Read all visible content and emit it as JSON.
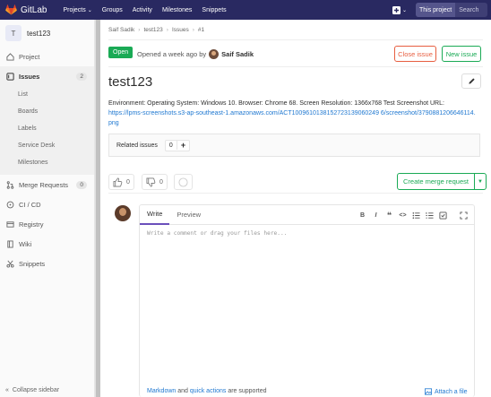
{
  "navbar": {
    "brand": "GitLab",
    "links": [
      "Projects",
      "Groups",
      "Activity",
      "Milestones",
      "Snippets"
    ],
    "search_scope": "This project",
    "search_placeholder": "Search"
  },
  "sidebar": {
    "project_initial": "T",
    "project_name": "test123",
    "items": {
      "project": "Project",
      "issues": "Issues",
      "issues_count": "2",
      "merge_requests": "Merge Requests",
      "merge_requests_count": "0",
      "ci_cd": "CI / CD",
      "registry": "Registry",
      "wiki": "Wiki",
      "snippets": "Snippets"
    },
    "issues_sub": [
      "List",
      "Boards",
      "Labels",
      "Service Desk",
      "Milestones"
    ],
    "collapse_label": "Collapse sidebar"
  },
  "breadcrumb": [
    "Saif Sadik",
    "test123",
    "Issues",
    "#1"
  ],
  "issue": {
    "status": "Open",
    "opened_text": "Opened a week ago by",
    "author": "Saif Sadik",
    "close_label": "Close issue",
    "new_label": "New issue",
    "title": "test123",
    "description_text": "Environment: Operating System: Windows 10. Browser: Chrome 68. Screen Resolution: 1366x768 Test Screenshot URL:",
    "description_link": "https://lpms-screenshots.s3-ap-southeast-1.amazonaws.com/ACT1009610138152723139060249 6/screenshot/37908812066461​14.png",
    "related_label": "Related issues",
    "related_count": "0",
    "thumbs_up": "0",
    "thumbs_down": "0",
    "merge_request_label": "Create merge request"
  },
  "editor": {
    "tab_write": "Write",
    "tab_preview": "Preview",
    "placeholder": "Write a comment or drag your files here...",
    "markdown_link": "Markdown",
    "and_text": "and",
    "quick_actions_link": "quick actions",
    "supported_text": "are supported",
    "attach_label": "Attach a file"
  },
  "colors": {
    "navbar": "#292961",
    "open_badge": "#1aaa55",
    "close_button": "#e75e40",
    "link": "#1f78d1"
  }
}
